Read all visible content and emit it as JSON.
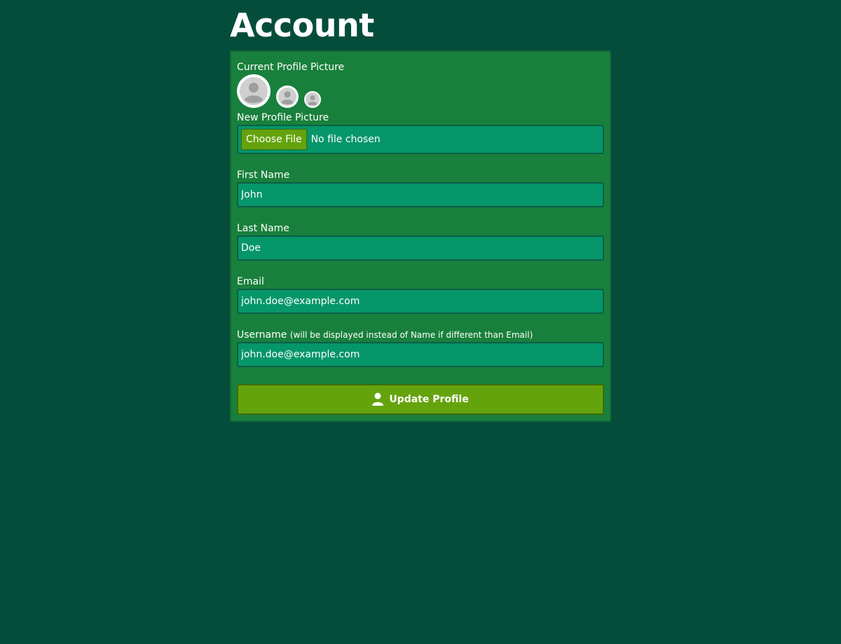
{
  "page": {
    "title": "Account"
  },
  "form": {
    "current_picture_label": "Current Profile Picture",
    "new_picture_label": "New Profile Picture",
    "file_input": {
      "button_label": "Choose File",
      "status": "No file chosen"
    },
    "first_name": {
      "label": "First Name",
      "value": "John"
    },
    "last_name": {
      "label": "Last Name",
      "value": "Doe"
    },
    "email": {
      "label": "Email",
      "value": "john.doe@example.com"
    },
    "username": {
      "label": "Username",
      "hint": "(will be displayed instead of Name if different than Email)",
      "value": "john.doe@example.com"
    },
    "submit": {
      "label": "Update Profile",
      "icon": "user-icon"
    }
  },
  "colors": {
    "background": "#054d3b",
    "card": "#18803c",
    "input": "#059669",
    "button": "#65a30d"
  }
}
